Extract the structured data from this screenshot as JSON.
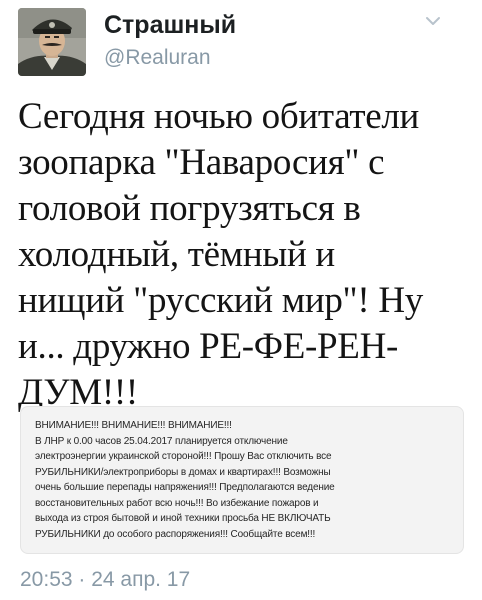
{
  "author": {
    "display_name": "Страшный",
    "handle": "@Realuran"
  },
  "icons": {
    "menu": "chevron-down-icon",
    "avatar": "user-avatar"
  },
  "tweet": {
    "text": "Сегодня ночью обитатели\nзоопарка \"Наваросия\" с\nголовой погрузяться в\nхолодный, тёмный и\nнищий \"русский мир\"! Ну\nи... дружно РЕ-ФЕ-РЕН-\nДУМ!!!",
    "timestamp": "20:53 · 24 апр. 17"
  },
  "attached_image": {
    "text": "ВНИМАНИЕ!!! ВНИМАНИЕ!!! ВНИМАНИЕ!!!\nВ ЛНР к 0.00 часов 25.04.2017 планируется отключение\nэлектроэнергии украинской стороной!!! Прошу Вас отключить все\nРУБИЛЬНИКИ/электроприборы в домах и квартирах!!! Возможны\nочень большие перепады напряжения!!! Предполагаются ведение\nвосстановительных работ всю ночь!!! Во избежание пожаров и\nвыхода из строя бытовой и иной техники просьба НЕ ВКЛЮЧАТЬ\nРУБИЛЬНИКИ до особого распоряжения!!! Сообщайте всем!!!"
  },
  "colors": {
    "name": "#1c2022",
    "secondary": "#8899a6",
    "card_background": "#f3f3f3"
  }
}
